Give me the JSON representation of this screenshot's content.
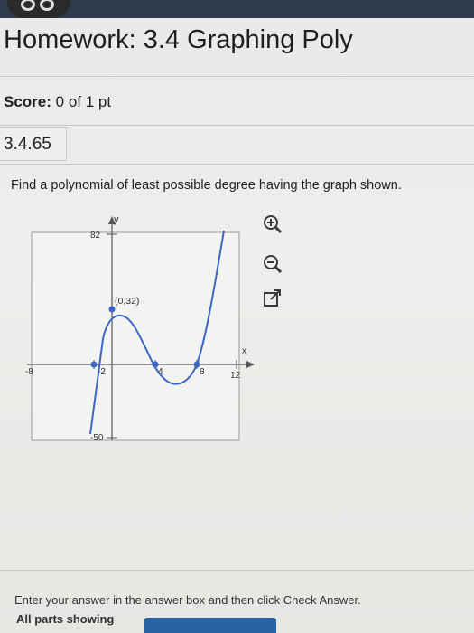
{
  "header": {
    "title": "Homework: 3.4 Graphing Poly"
  },
  "score": {
    "label": "Score:",
    "value": "0 of 1 pt"
  },
  "question": {
    "number": "3.4.65",
    "prompt": "Find a polynomial of least possible degree having the graph shown."
  },
  "graph": {
    "x_axis_label": "x",
    "y_axis_label": "y",
    "tick_labels": {
      "x_min": "-8",
      "x_neg2": "-2",
      "x_4": "4",
      "x_8": "8",
      "x_max": "12",
      "y_max": "82",
      "y_min": "-50"
    },
    "point_label": "(0,32)",
    "curve_color": "#3b66c4"
  },
  "tools": {
    "zoom_in": "zoom-in-icon",
    "zoom_out": "zoom-out-icon",
    "popout": "popout-icon"
  },
  "footer": {
    "instruction": "Enter your answer in the answer box and then click Check Answer.",
    "parts_label": "All parts showing"
  }
}
